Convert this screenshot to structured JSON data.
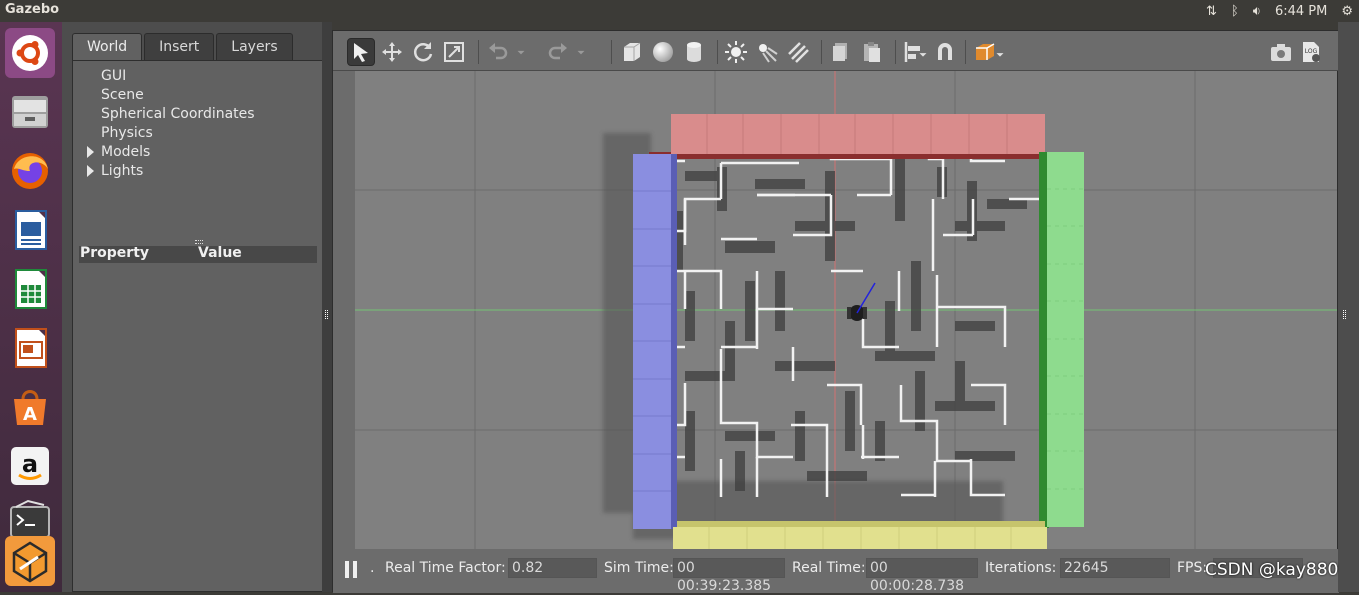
{
  "topbar": {
    "app_title": "Gazebo",
    "clock": "6:44 PM",
    "icons": [
      "network-updown-icon",
      "bluetooth-icon",
      "volume-icon",
      "gear-icon"
    ]
  },
  "launcher": {
    "icons": [
      "ubuntu-dash-icon",
      "files-icon",
      "firefox-icon",
      "writer-icon",
      "calc-icon",
      "impress-icon",
      "software-center-icon",
      "amazon-icon",
      "terminal-icon",
      "gazebo-icon"
    ],
    "amazon_letter": "a"
  },
  "left_panel": {
    "tabs": [
      {
        "label": "World",
        "active": true
      },
      {
        "label": "Insert",
        "active": false
      },
      {
        "label": "Layers",
        "active": false
      }
    ],
    "tree": [
      "GUI",
      "Scene",
      "Spherical Coordinates",
      "Physics",
      "Models",
      "Lights"
    ],
    "property_header": {
      "property": "Property",
      "value": "Value"
    }
  },
  "toolbar": {
    "tools": [
      "select-arrow-icon",
      "translate-icon",
      "rotate-icon",
      "scale-icon",
      "undo-icon",
      "redo-icon",
      "box-icon",
      "sphere-icon",
      "cylinder-icon",
      "point-light-icon",
      "spot-light-icon",
      "directional-light-icon",
      "copy-icon",
      "paste-icon",
      "align-icon",
      "snap-magnet-icon",
      "view-angle-icon",
      "screenshot-icon",
      "log-icon"
    ]
  },
  "statusbar": {
    "rtf_label": "Real Time Factor:",
    "rtf_value": "0.82",
    "sim_label": "Sim Time:",
    "sim_value": "00 00:39:23.385",
    "real_label": "Real Time:",
    "real_value": "00 00:00:28.738",
    "iter_label": "Iterations:",
    "iter_value": "22645",
    "fps_label": "FPS:",
    "dot": "."
  },
  "watermark": "CSDN @kay880",
  "colors": {
    "wall_red": "#d98c8c",
    "wall_blue": "#8a8ee0",
    "wall_green": "#8edb8e",
    "wall_yellow": "#e1e08e",
    "ground": "#7f7f7f"
  }
}
